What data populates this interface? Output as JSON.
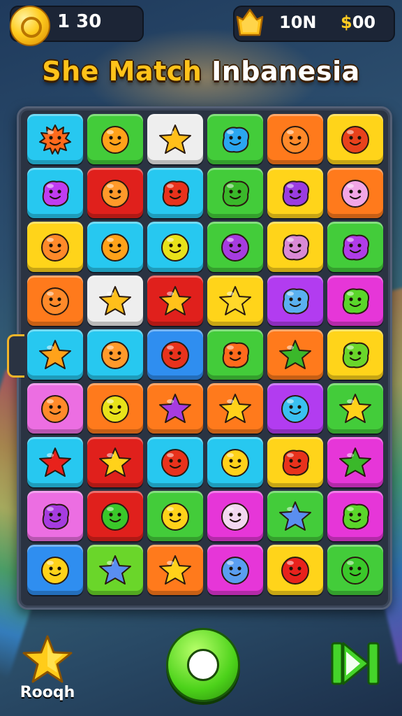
{
  "hud": {
    "coins_value": "1 30",
    "right_value_a": "10N",
    "right_value_b_symbol": "$",
    "right_value_b_rest": "00"
  },
  "title": {
    "part1": "She Match",
    "part2": "Inbanesia"
  },
  "board": {
    "rows": [
      [
        {
          "color": "c-cyan",
          "icon": "sun-creature-icon",
          "fill": "#ff6a1c",
          "shape": "sun"
        },
        {
          "color": "c-green",
          "icon": "orange-smiley-icon",
          "fill": "#ffa21a",
          "shape": "round"
        },
        {
          "color": "c-white",
          "icon": "layered-star-icon",
          "fill": "#ffbf1a",
          "shape": "star"
        },
        {
          "color": "c-green",
          "icon": "blue-bubble-icon",
          "fill": "#2aa6f0",
          "shape": "blob"
        },
        {
          "color": "c-orange",
          "icon": "orange-crab-icon",
          "fill": "#ff8a2a",
          "shape": "round"
        },
        {
          "color": "c-yellow",
          "icon": "red-crab-icon",
          "fill": "#e8421c",
          "shape": "round"
        }
      ],
      [
        {
          "color": "c-cyan",
          "icon": "purple-blob-icon",
          "fill": "#c03cf0",
          "shape": "blob"
        },
        {
          "color": "c-red",
          "icon": "orange-bear-icon",
          "fill": "#ff9a2a",
          "shape": "round"
        },
        {
          "color": "c-cyan",
          "icon": "red-blob-icon",
          "fill": "#e8321c",
          "shape": "blob"
        },
        {
          "color": "c-green",
          "icon": "green-bush-icon",
          "fill": "#3ab82a",
          "shape": "blob"
        },
        {
          "color": "c-yellow",
          "icon": "purple-cloud-icon",
          "fill": "#9a3ce0",
          "shape": "blob"
        },
        {
          "color": "c-orange",
          "icon": "pink-bunny-icon",
          "fill": "#f2a6e6",
          "shape": "round"
        }
      ],
      [
        {
          "color": "c-yellow",
          "icon": "orange-bear-icon",
          "fill": "#ff8a2a",
          "shape": "round"
        },
        {
          "color": "c-cyan",
          "icon": "orange-smiley-icon",
          "fill": "#ffa21a",
          "shape": "round"
        },
        {
          "color": "c-cyan",
          "icon": "yellow-cat-icon",
          "fill": "#e8e21a",
          "shape": "round"
        },
        {
          "color": "c-green",
          "icon": "purple-ball-icon",
          "fill": "#a63ce0",
          "shape": "round"
        },
        {
          "color": "c-yellow",
          "icon": "pink-fish-icon",
          "fill": "#d98ad6",
          "shape": "blob"
        },
        {
          "color": "c-green",
          "icon": "purple-blob-icon",
          "fill": "#b03ce8",
          "shape": "blob"
        }
      ],
      [
        {
          "color": "c-orange",
          "icon": "orange-bear-icon",
          "fill": "#ff8a2a",
          "shape": "round"
        },
        {
          "color": "c-white",
          "icon": "layered-star-icon",
          "fill": "#ffbf1a",
          "shape": "star"
        },
        {
          "color": "c-red",
          "icon": "yellow-star-icon",
          "fill": "#ffc21a",
          "shape": "star"
        },
        {
          "color": "c-yellow",
          "icon": "yellow-star-icon",
          "fill": "#ffd82a",
          "shape": "star"
        },
        {
          "color": "c-purple",
          "icon": "blue-monster-icon",
          "fill": "#5ab0f0",
          "shape": "blob"
        },
        {
          "color": "c-magenta",
          "icon": "green-leaf-icon",
          "fill": "#5ad62a",
          "shape": "blob"
        }
      ],
      [
        {
          "color": "c-cyan",
          "icon": "layered-star-icon",
          "fill": "#ffa21a",
          "shape": "star"
        },
        {
          "color": "c-cyan",
          "icon": "orange-bear-icon",
          "fill": "#ff9a2a",
          "shape": "round"
        },
        {
          "color": "c-blue",
          "icon": "red-bear-icon",
          "fill": "#e8321c",
          "shape": "round"
        },
        {
          "color": "c-green",
          "icon": "orange-heart-icon",
          "fill": "#ff6a1c",
          "shape": "blob"
        },
        {
          "color": "c-orange",
          "icon": "green-triangle-icon",
          "fill": "#3ab82a",
          "shape": "star"
        },
        {
          "color": "c-yellow",
          "icon": "green-cactus-icon",
          "fill": "#6ad62a",
          "shape": "blob"
        }
      ],
      [
        {
          "color": "c-pink",
          "icon": "orange-bear-icon",
          "fill": "#ff8a2a",
          "shape": "round"
        },
        {
          "color": "c-orange",
          "icon": "yellow-smiley-icon",
          "fill": "#e8e21a",
          "shape": "round"
        },
        {
          "color": "c-orange",
          "icon": "purple-star-icon",
          "fill": "#a63ce0",
          "shape": "star"
        },
        {
          "color": "c-orange",
          "icon": "yellow-star-icon",
          "fill": "#ffd21a",
          "shape": "star"
        },
        {
          "color": "c-purple",
          "icon": "blue-ball-icon",
          "fill": "#3ac0f0",
          "shape": "round"
        },
        {
          "color": "c-green",
          "icon": "yellow-star-icon",
          "fill": "#ffd21a",
          "shape": "star"
        }
      ],
      [
        {
          "color": "c-cyan",
          "icon": "red-star-icon",
          "fill": "#e8221c",
          "shape": "star"
        },
        {
          "color": "c-red",
          "icon": "yellow-star-icon",
          "fill": "#ffd21a",
          "shape": "star"
        },
        {
          "color": "c-cyan",
          "icon": "red-bear-icon",
          "fill": "#e8321c",
          "shape": "round"
        },
        {
          "color": "c-cyan",
          "icon": "yellow-bear-icon",
          "fill": "#ffd21a",
          "shape": "round"
        },
        {
          "color": "c-yellow",
          "icon": "red-fish-icon",
          "fill": "#e8321c",
          "shape": "blob"
        },
        {
          "color": "c-magenta",
          "icon": "green-leaf-icon",
          "fill": "#3ab82a",
          "shape": "star"
        }
      ],
      [
        {
          "color": "c-pink",
          "icon": "purple-box-icon",
          "fill": "#a63ce0",
          "shape": "blob"
        },
        {
          "color": "c-red",
          "icon": "green-ball-icon",
          "fill": "#3ac82a",
          "shape": "round"
        },
        {
          "color": "c-green",
          "icon": "yellow-ring-icon",
          "fill": "#ffd21a",
          "shape": "round"
        },
        {
          "color": "c-magenta",
          "icon": "white-bear-icon",
          "fill": "#f2d8f0",
          "shape": "round"
        },
        {
          "color": "c-green",
          "icon": "blue-crystal-icon",
          "fill": "#5a8ef0",
          "shape": "star"
        },
        {
          "color": "c-magenta",
          "icon": "green-card-icon",
          "fill": "#5ad62a",
          "shape": "blob"
        }
      ],
      [
        {
          "color": "c-blue",
          "icon": "yellow-bear-icon",
          "fill": "#ffd21a",
          "shape": "round"
        },
        {
          "color": "c-lime",
          "icon": "blue-star-icon",
          "fill": "#5a8ef0",
          "shape": "star"
        },
        {
          "color": "c-orange",
          "icon": "yellow-star-icon",
          "fill": "#ffd21a",
          "shape": "star"
        },
        {
          "color": "c-magenta",
          "icon": "blue-berry-icon",
          "fill": "#5a9ef0",
          "shape": "round"
        },
        {
          "color": "c-yellow",
          "icon": "red-bomb-icon",
          "fill": "#e8221c",
          "shape": "round"
        },
        {
          "color": "c-green",
          "icon": "green-smiley-icon",
          "fill": "#3ac82a",
          "shape": "round"
        }
      ]
    ]
  },
  "bottom": {
    "star_label": "Rooqh"
  }
}
